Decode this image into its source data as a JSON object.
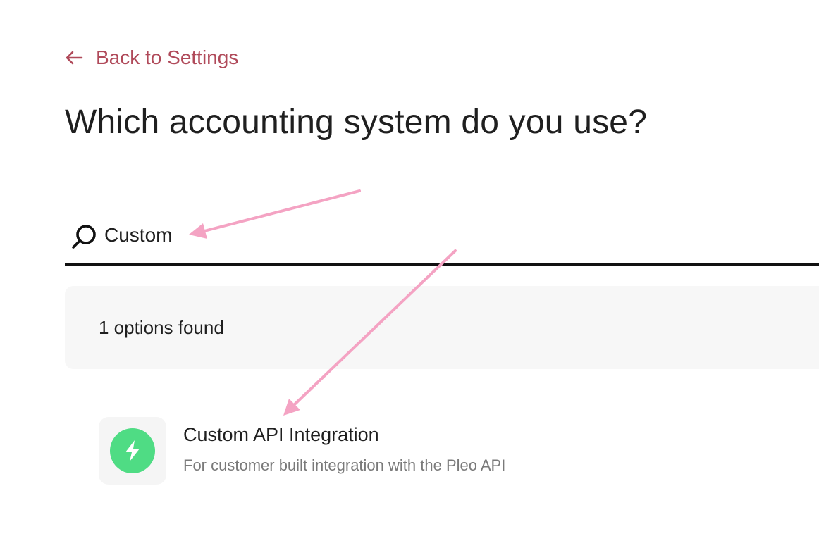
{
  "nav": {
    "back_label": "Back to Settings",
    "back_icon": "arrow-left-icon"
  },
  "page": {
    "title": "Which accounting system do you use?"
  },
  "search": {
    "icon": "search-icon",
    "value": "Custom"
  },
  "results": {
    "count_label": "1 options found",
    "items": [
      {
        "title": "Custom API Integration",
        "description": "For customer built integration with the Pleo API",
        "icon": "lightning-bolt-icon"
      }
    ]
  },
  "colors": {
    "link": "#b04a5a",
    "option_logo_bg": "#4fdc84",
    "annotation_arrow": "#f4a3c3"
  }
}
